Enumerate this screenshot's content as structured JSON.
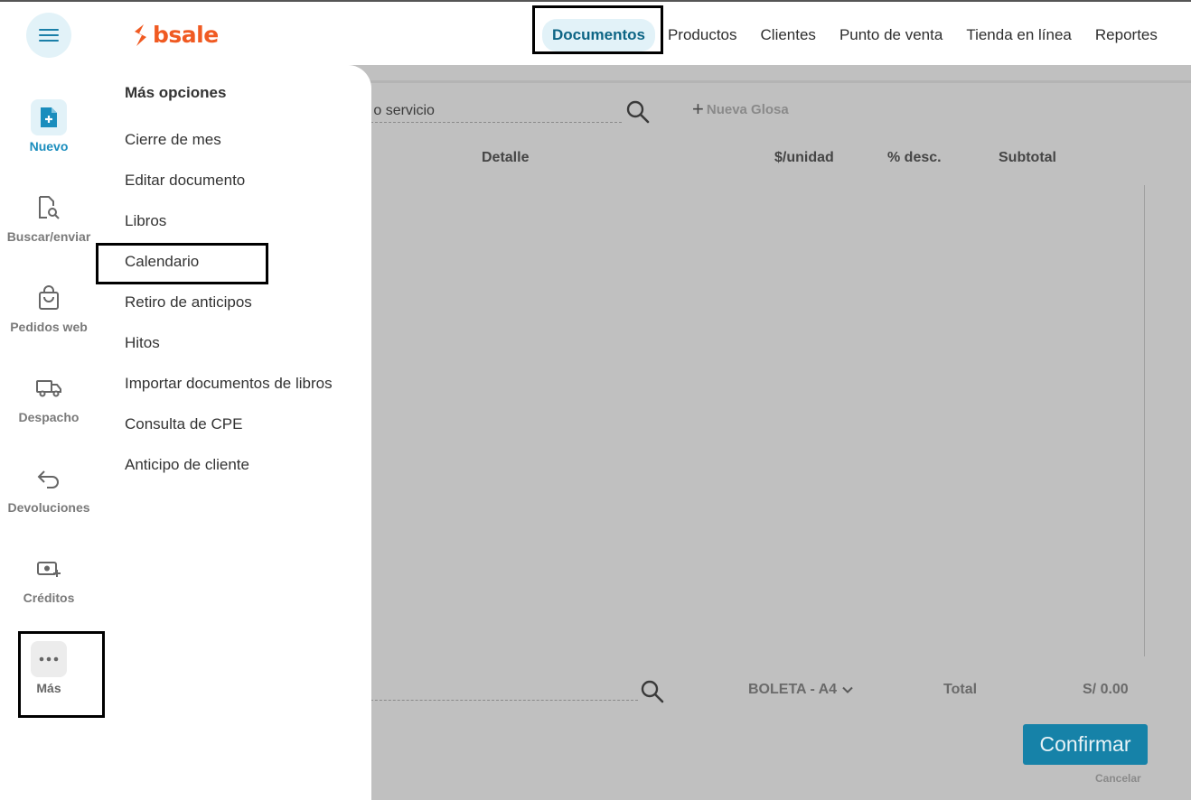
{
  "brand": {
    "name": "bsale",
    "color": "#f05a22"
  },
  "accent_color": "#1682a8",
  "topnav": {
    "items": [
      {
        "label": "Documentos",
        "active": true
      },
      {
        "label": "Productos"
      },
      {
        "label": "Clientes"
      },
      {
        "label": "Punto de venta"
      },
      {
        "label": "Tienda en línea"
      },
      {
        "label": "Reportes"
      }
    ]
  },
  "sidebar": {
    "items": [
      {
        "label": "Nuevo",
        "icon": "document-plus-icon",
        "active": true
      },
      {
        "label": "Buscar/enviar",
        "icon": "document-search-icon"
      },
      {
        "label": "Pedidos web",
        "icon": "shopping-bag-icon"
      },
      {
        "label": "Despacho",
        "icon": "truck-icon"
      },
      {
        "label": "Devoluciones",
        "icon": "return-arrow-icon"
      },
      {
        "label": "Créditos",
        "icon": "money-plus-icon"
      },
      {
        "label": "Más",
        "icon": "more-dots-icon"
      }
    ]
  },
  "more_menu": {
    "title": "Más opciones",
    "items": [
      "Cierre de mes",
      "Editar documento",
      "Libros",
      "Calendario",
      "Retiro de anticipos",
      "Hitos",
      "Importar documentos de libros",
      "Consulta de CPE",
      "Anticipo de cliente"
    ]
  },
  "editor": {
    "search_text": "o o servicio",
    "new_line_label": "Nueva Glosa",
    "columns": [
      "Detalle",
      "$/unidad",
      "% desc.",
      "Subtotal"
    ],
    "document_type": "BOLETA - A4",
    "total_label": "Total",
    "total_value": "S/ 0.00",
    "confirm_label": "Confirmar",
    "cancel_label": "Cancelar"
  }
}
